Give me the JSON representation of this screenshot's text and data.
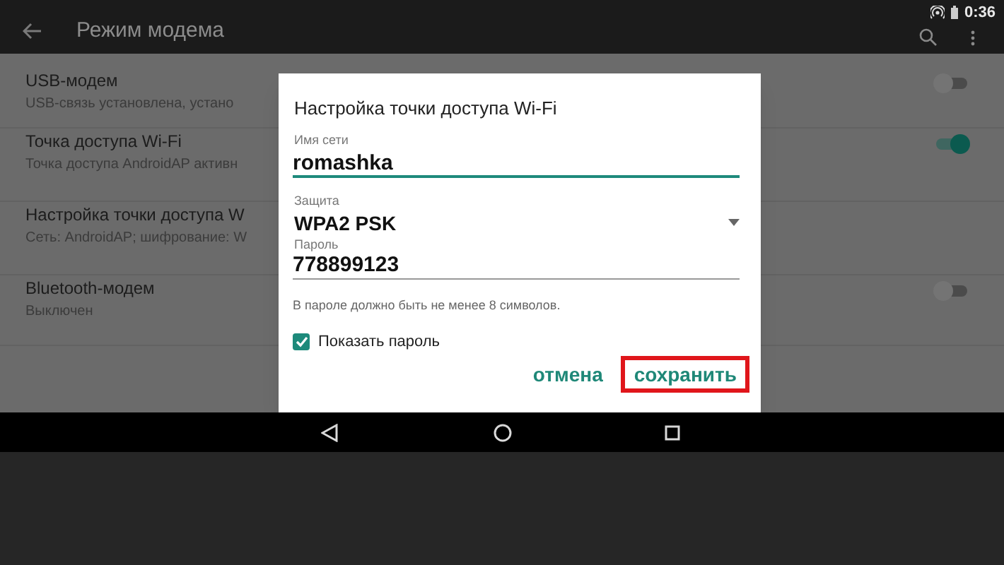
{
  "status_bar": {
    "time": "0:36"
  },
  "toolbar": {
    "title": "Режим модема"
  },
  "settings": [
    {
      "kind": "switch",
      "title": "USB-модем",
      "subtitle": "USB-связь установлена, устано",
      "on": false
    },
    {
      "kind": "switch",
      "title": "Точка доступа Wi-Fi",
      "subtitle": "Точка доступа AndroidAP активн",
      "on": true
    },
    {
      "kind": "link",
      "title": "Настройка точки доступа W",
      "subtitle": "Сеть: AndroidAP; шифрование: W"
    },
    {
      "kind": "switch",
      "title": "Bluetooth-модем",
      "subtitle": "Выключен",
      "on": false
    }
  ],
  "dialog": {
    "title": "Настройка точки доступа Wi-Fi",
    "fields": [
      {
        "kind": "text",
        "label": "Имя сети",
        "value": "romashka",
        "focused": true
      },
      {
        "kind": "select",
        "label": "Защита",
        "value": "WPA2 PSK"
      },
      {
        "kind": "text",
        "label": "Пароль",
        "value": "778899123",
        "focused": false
      }
    ],
    "hint": "В пароле должно быть не менее 8 символов.",
    "checkbox": {
      "label": "Показать пароль",
      "checked": true
    },
    "buttons": [
      {
        "label": "отмена",
        "highlighted": false
      },
      {
        "label": "сохранить",
        "highlighted": true
      }
    ]
  }
}
